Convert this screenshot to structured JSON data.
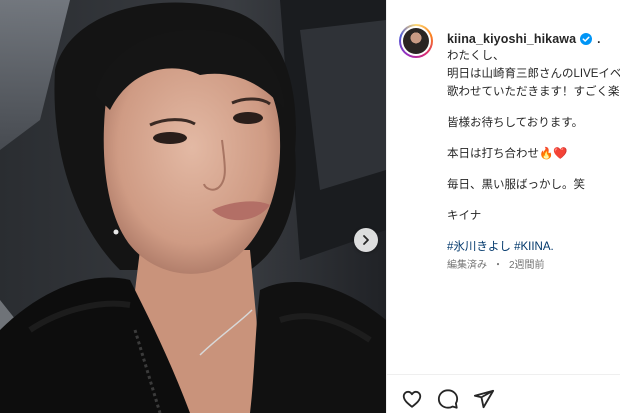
{
  "post": {
    "username": "kiina_kiyoshi_hikawa",
    "verified": true,
    "separator": ".",
    "caption_lines": [
      "わたくし、",
      "明日は山崎育三郎さんのLIVEイベ",
      "歌わせていただきます！すごく楽",
      "",
      "皆様お待ちしております。",
      "",
      "本日は打ち合わせ🔥❤️",
      "",
      "毎日、黒い服ばっかし。笑",
      "",
      "キイナ"
    ],
    "hashtags": "#氷川きよし #KIINA.",
    "edited_label": "編集済み",
    "separator_dot": "・",
    "time_ago": "2週間前"
  },
  "media": {
    "next_icon": "chevron-right-icon"
  },
  "actions": [
    {
      "name": "like",
      "icon": "heart-icon"
    },
    {
      "name": "comment",
      "icon": "comment-icon"
    },
    {
      "name": "share",
      "icon": "paper-plane-icon"
    }
  ],
  "colors": {
    "link": "#00376b",
    "verified": "#0095f6",
    "text": "#262626",
    "muted": "#737373"
  }
}
